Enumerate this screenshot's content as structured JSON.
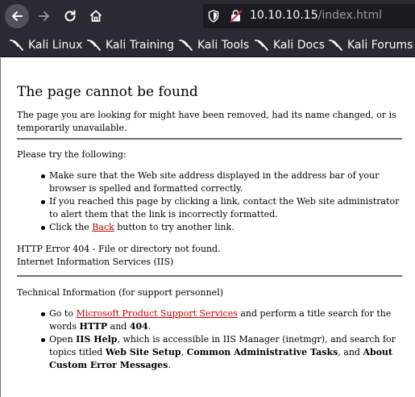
{
  "browser": {
    "url_host": "10.10.10.15",
    "url_path": "/index.html",
    "bookmarks": [
      "Kali Linux",
      "Kali Training",
      "Kali Tools",
      "Kali Docs",
      "Kali Forums"
    ]
  },
  "page": {
    "title": "The page cannot be found",
    "intro": "The page you are looking for might have been removed, had its name changed, or is temporarily unavailable.",
    "try_heading": "Please try the following:",
    "try_items": {
      "item1": "Make sure that the Web site address displayed in the address bar of your browser is spelled and formatted correctly.",
      "item2": "If you reached this page by clicking a link, contact the Web site administrator to alert them that the link is incorrectly formatted.",
      "item3_pre": "Click the ",
      "item3_link": "Back",
      "item3_post": " button to try another link."
    },
    "error_line": "HTTP Error 404 - File or directory not found.",
    "server_line": "Internet Information Services (IIS)",
    "tech_heading": "Technical Information (for support personnel)",
    "tech_items": {
      "goto_pre": "Go to ",
      "goto_link": "Microsoft Product Support Services",
      "goto_mid": " and perform a title search for the words ",
      "goto_b1": "HTTP",
      "goto_and": " and ",
      "goto_b2": "404",
      "goto_end": ".",
      "open_pre": "Open ",
      "open_b1": "IIS Help",
      "open_mid": ", which is accessible in IIS Manager (inetmgr), and search for topics titled ",
      "open_b2": "Web Site Setup",
      "open_comma": ", ",
      "open_b3": "Common Administrative Tasks",
      "open_and": ", and ",
      "open_b4": "About Custom Error Messages",
      "open_end": "."
    }
  },
  "colors": {
    "chrome_bg": "#2b2a33",
    "urlbar_bg": "#1c1b22",
    "link": "#cc0000"
  }
}
